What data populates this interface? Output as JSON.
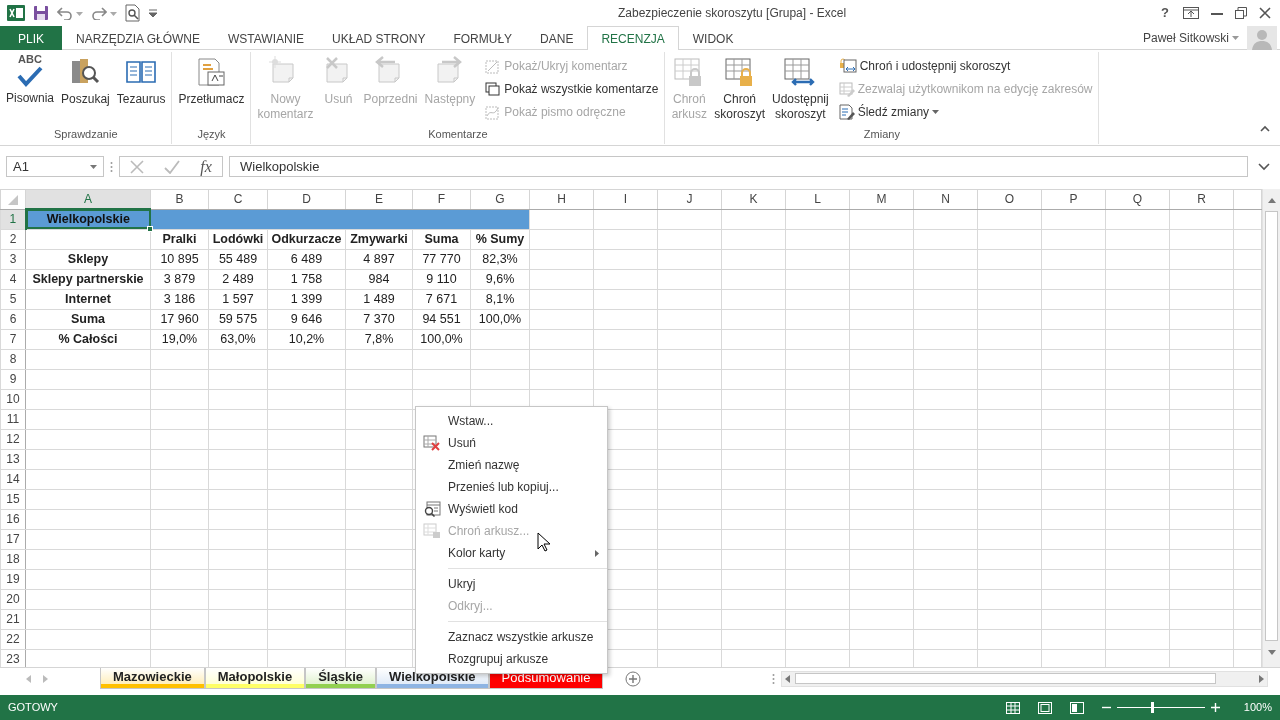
{
  "window": {
    "title": "Zabezpieczenie skoroszytu  [Grupa] - Excel",
    "help": "?"
  },
  "ribbon_tabs": [
    {
      "label": "PLIK",
      "kind": "file",
      "selected": false
    },
    {
      "label": "NARZĘDZIA GŁÓWNE",
      "kind": "tab",
      "selected": false
    },
    {
      "label": "WSTAWIANIE",
      "kind": "tab",
      "selected": false
    },
    {
      "label": "UKŁAD STRONY",
      "kind": "tab",
      "selected": false
    },
    {
      "label": "FORMUŁY",
      "kind": "tab",
      "selected": false
    },
    {
      "label": "DANE",
      "kind": "tab",
      "selected": false
    },
    {
      "label": "RECENZJA",
      "kind": "tab",
      "selected": true
    },
    {
      "label": "WIDOK",
      "kind": "tab",
      "selected": false
    }
  ],
  "user": {
    "name": "Paweł Sitkowski"
  },
  "ribbon_groups": [
    {
      "label": "Sprawdzanie",
      "large": [
        {
          "label": "Pisownia",
          "icon_text": "ABC",
          "disabled": false
        },
        {
          "label": "Poszukaj",
          "disabled": false
        },
        {
          "label": "Tezaurus",
          "disabled": false
        }
      ]
    },
    {
      "label": "Język",
      "large": [
        {
          "label": "Przetłumacz",
          "disabled": false
        }
      ]
    },
    {
      "label": "Komentarze",
      "large": [
        {
          "label": "Nowy\nkomentarz",
          "disabled": true
        },
        {
          "label": "Usuń",
          "disabled": true
        },
        {
          "label": "Poprzedni",
          "disabled": true
        },
        {
          "label": "Następny",
          "disabled": true
        }
      ],
      "small": [
        {
          "label": "Pokaż/Ukryj komentarz",
          "disabled": true,
          "dropdown": false
        },
        {
          "label": "Pokaż wszystkie komentarze",
          "disabled": false,
          "dropdown": false
        },
        {
          "label": "Pokaż pismo odręczne",
          "disabled": true,
          "dropdown": false
        }
      ]
    },
    {
      "label": "Zmiany",
      "large": [
        {
          "label": "Chroń\narkusz",
          "disabled": true
        },
        {
          "label": "Chroń\nskoroszyt",
          "disabled": false
        },
        {
          "label": "Udostępnij\nskoroszyt",
          "disabled": false
        }
      ],
      "small": [
        {
          "label": "Chroń i udostępnij skoroszyt",
          "disabled": false,
          "dropdown": false
        },
        {
          "label": "Zezwalaj użytkownikom na edycję zakresów",
          "disabled": true,
          "dropdown": false
        },
        {
          "label": "Śledź zmiany",
          "disabled": false,
          "dropdown": true
        }
      ]
    }
  ],
  "formula_bar": {
    "name_box": "A1",
    "fx": "fx",
    "content": "Wielkopolskie"
  },
  "columns": [
    {
      "label": "A",
      "selected": true
    },
    {
      "label": "B",
      "selected": false
    },
    {
      "label": "C",
      "selected": false
    },
    {
      "label": "D",
      "selected": false
    },
    {
      "label": "E",
      "selected": false
    },
    {
      "label": "F",
      "selected": false
    },
    {
      "label": "G",
      "selected": false
    },
    {
      "label": "H",
      "selected": false
    },
    {
      "label": "I",
      "selected": false
    },
    {
      "label": "J",
      "selected": false
    },
    {
      "label": "K",
      "selected": false
    },
    {
      "label": "L",
      "selected": false
    },
    {
      "label": "M",
      "selected": false
    },
    {
      "label": "N",
      "selected": false
    },
    {
      "label": "O",
      "selected": false
    },
    {
      "label": "P",
      "selected": false
    },
    {
      "label": "Q",
      "selected": false
    },
    {
      "label": "R",
      "selected": false
    }
  ],
  "row_numbers": [
    {
      "label": "1",
      "selected": true
    },
    {
      "label": "2",
      "selected": false
    },
    {
      "label": "3",
      "selected": false
    },
    {
      "label": "4",
      "selected": false
    },
    {
      "label": "5",
      "selected": false
    },
    {
      "label": "6",
      "selected": false
    },
    {
      "label": "7",
      "selected": false
    },
    {
      "label": "8",
      "selected": false
    },
    {
      "label": "9",
      "selected": false
    },
    {
      "label": "10",
      "selected": false
    },
    {
      "label": "11",
      "selected": false
    },
    {
      "label": "12",
      "selected": false
    },
    {
      "label": "13",
      "selected": false
    },
    {
      "label": "14",
      "selected": false
    },
    {
      "label": "15",
      "selected": false
    },
    {
      "label": "16",
      "selected": false
    },
    {
      "label": "17",
      "selected": false
    },
    {
      "label": "18",
      "selected": false
    },
    {
      "label": "19",
      "selected": false
    },
    {
      "label": "20",
      "selected": false
    },
    {
      "label": "21",
      "selected": false
    },
    {
      "label": "22",
      "selected": false
    },
    {
      "label": "23",
      "selected": false
    }
  ],
  "rows": [
    {
      "kind": "banner",
      "cells": [
        {
          "text": "Wielkopolskie",
          "selected": true
        }
      ]
    },
    {
      "kind": "header",
      "cells": [
        "Pralki",
        "Lodówki",
        "Odkurzacze",
        "Zmywarki",
        "Suma",
        "% Sumy"
      ]
    },
    {
      "kind": "data",
      "cells": [
        "Sklepy",
        "10 895",
        "55 489",
        "6 489",
        "4 897",
        "77 770",
        "82,3%"
      ]
    },
    {
      "kind": "data",
      "cells": [
        "Sklepy partnerskie",
        "3 879",
        "2 489",
        "1 758",
        "984",
        "9 110",
        "9,6%"
      ]
    },
    {
      "kind": "data",
      "cells": [
        "Internet",
        "3 186",
        "1 597",
        "1 399",
        "1 489",
        "7 671",
        "8,1%"
      ]
    },
    {
      "kind": "data",
      "cells": [
        "Suma",
        "17 960",
        "59 575",
        "9 646",
        "7 370",
        "94 551",
        "100,0%"
      ]
    },
    {
      "kind": "data",
      "cells": [
        "% Całości",
        "19,0%",
        "63,0%",
        "10,2%",
        "7,8%",
        "100,0%"
      ]
    }
  ],
  "context_menu": [
    [
      {
        "label": "Wstaw...",
        "disabled": false,
        "submenu": false
      },
      {
        "label": "Usuń",
        "disabled": false,
        "submenu": false
      },
      {
        "label": "Zmień nazwę",
        "disabled": false,
        "submenu": false
      },
      {
        "label": "Przenieś lub kopiuj...",
        "disabled": false,
        "submenu": false
      },
      {
        "label": "Wyświetl kod",
        "disabled": false,
        "submenu": false
      },
      {
        "label": "Chroń arkusz...",
        "disabled": true,
        "submenu": false
      },
      {
        "label": "Kolor karty",
        "disabled": false,
        "submenu": true
      }
    ],
    [
      {
        "label": "Ukryj",
        "disabled": false,
        "submenu": false
      },
      {
        "label": "Odkryj...",
        "disabled": true,
        "submenu": false
      }
    ],
    [
      {
        "label": "Zaznacz wszystkie arkusze",
        "disabled": false,
        "submenu": false
      },
      {
        "label": "Rozgrupuj arkusze",
        "disabled": false,
        "submenu": false
      }
    ]
  ],
  "sheet_tabs": [
    {
      "label": "Mazowieckie",
      "color": "#ffc000",
      "selected": true
    },
    {
      "label": "Małopolskie",
      "color": "#ffff66",
      "selected": true
    },
    {
      "label": "Śląskie",
      "color": "#92d050",
      "selected": true
    },
    {
      "label": "Wielkopolskie",
      "color": "#8eb4e3",
      "selected": true
    },
    {
      "label": "Podsumowanie",
      "color": "#ff0000",
      "selected": false
    }
  ],
  "status_bar": {
    "status": "GOTOWY",
    "zoom": "100%",
    "zoom_slider": {
      "level": 0.4
    }
  }
}
